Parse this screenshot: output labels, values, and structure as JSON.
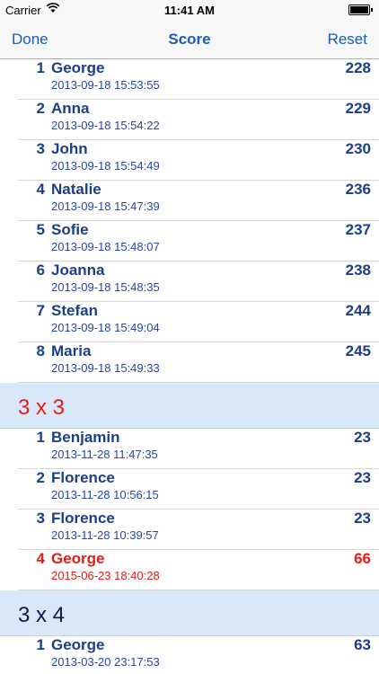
{
  "statusbar": {
    "carrier": "Carrier",
    "time": "11:41 AM"
  },
  "navbar": {
    "done_label": "Done",
    "title": "Score",
    "reset_label": "Reset"
  },
  "groups": [
    {
      "header": "",
      "entries": [
        {
          "rank": "1",
          "name": "George",
          "date": "2013-09-18 15:53:55",
          "score": "228"
        },
        {
          "rank": "2",
          "name": "Anna",
          "date": "2013-09-18 15:54:22",
          "score": "229"
        },
        {
          "rank": "3",
          "name": "John",
          "date": "2013-09-18 15:54:49",
          "score": "230"
        },
        {
          "rank": "4",
          "name": "Natalie",
          "date": "2013-09-18 15:47:39",
          "score": "236"
        },
        {
          "rank": "5",
          "name": "Sofie",
          "date": "2013-09-18 15:48:07",
          "score": "237"
        },
        {
          "rank": "6",
          "name": "Joanna",
          "date": "2013-09-18 15:48:35",
          "score": "238"
        },
        {
          "rank": "7",
          "name": "Stefan",
          "date": "2013-09-18 15:49:04",
          "score": "244"
        },
        {
          "rank": "8",
          "name": "Maria",
          "date": "2013-09-18 15:49:33",
          "score": "245"
        }
      ]
    },
    {
      "header": "3 x 3",
      "header_color": "#e41b17",
      "entries": [
        {
          "rank": "1",
          "name": "Benjamin",
          "date": "2013-11-28 11:47:35",
          "score": "23"
        },
        {
          "rank": "2",
          "name": "Florence",
          "date": "2013-11-28 10:56:15",
          "score": "23"
        },
        {
          "rank": "3",
          "name": "Florence",
          "date": "2013-11-28 10:39:57",
          "score": "23"
        },
        {
          "rank": "4",
          "name": "George",
          "date": "2015-06-23 18:40:28",
          "score": "66",
          "highlighted": true
        }
      ]
    },
    {
      "header": "3 x 4",
      "header_color": "#0d1a4a",
      "entries": [
        {
          "rank": "1",
          "name": "George",
          "date": "2013-03-20 23:17:53",
          "score": "63"
        }
      ]
    }
  ],
  "colors": {
    "accent": "#1a5bb5",
    "highlight": "#e41b17",
    "section_bg": "#d9e8f9"
  }
}
